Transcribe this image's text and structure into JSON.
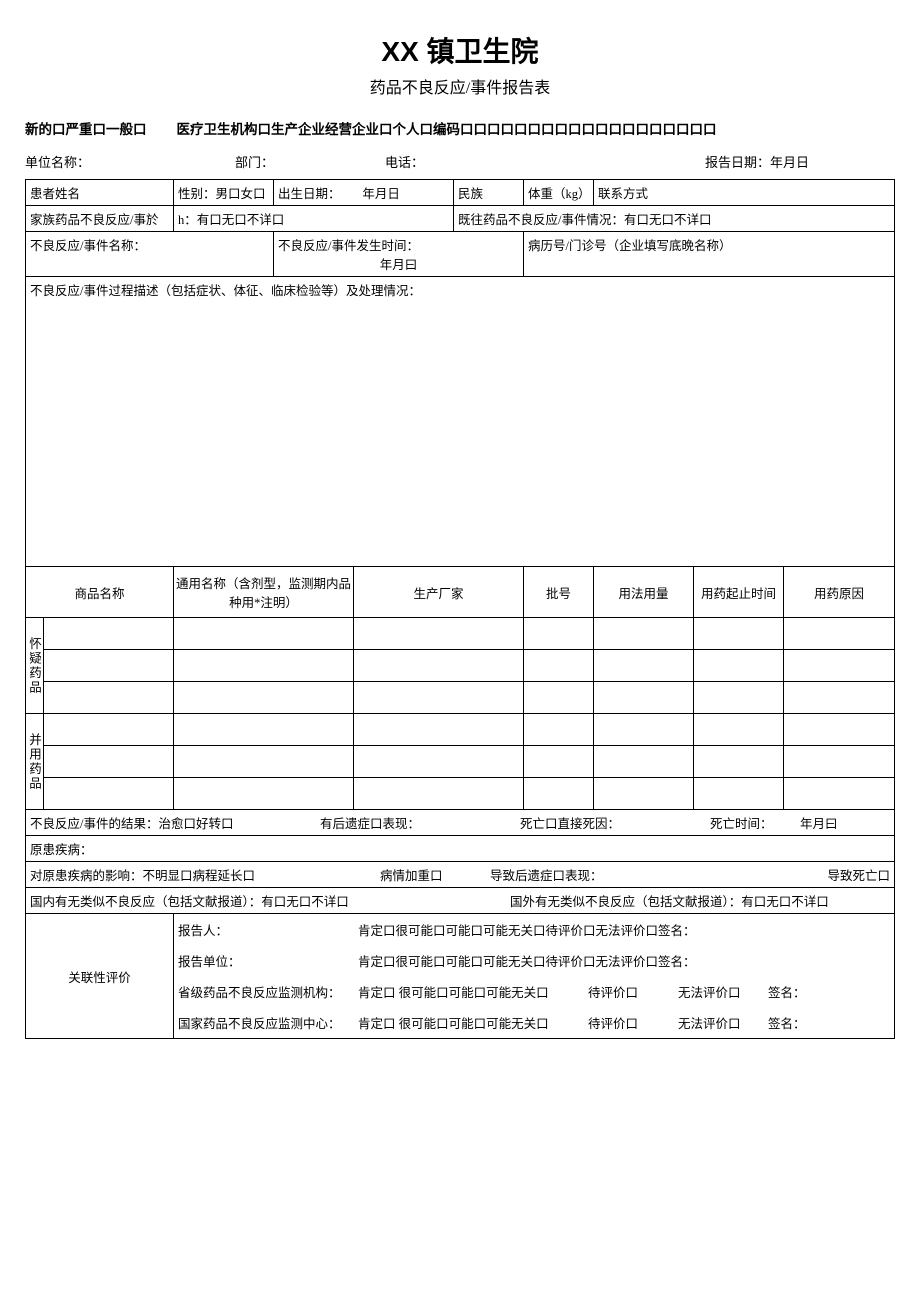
{
  "title": "XX 镇卫生院",
  "subtitle": "药品不良反应/事件报告表",
  "header": {
    "typeLine": "新的口严重口一般口",
    "sourceLine": "医疗卫生机构口生产企业经营企业口个人口编码口口口口口口口口口口口口口口口口口口口"
  },
  "info": {
    "unitLabel": "单位名称：",
    "deptLabel": "部门：",
    "phoneLabel": "电话：",
    "dateLabel": "报告日期：年月日"
  },
  "patient": {
    "nameLabel": "患者姓名",
    "sexLabel": "性别：男口女口",
    "birthLabel": "出生日期：",
    "birthValue": "年月日",
    "ethnicLabel": "民族",
    "weightLabel": "体重（kg）",
    "contactLabel": "联系方式"
  },
  "history": {
    "familyLabel": "家族药品不良反应/事於",
    "familyValue": "h：有口无口不详口",
    "pastLabel": "既往药品不良反应/事件情况：有口无口不详口"
  },
  "event": {
    "nameLabel": "不良反应/事件名称：",
    "timeLabel": "不良反应/事件发生时间：",
    "timeValue": "年月曰",
    "recordLabel": "病历号/门诊号（企业填写底晩名称）",
    "descLabel": "不良反应/事件过程描述（包括症状、体征、临床检验等）及处理情况："
  },
  "drugCols": {
    "tradeName": "商品名称",
    "genericName": "通用名称（含剂型，监测期内品种用*注明）",
    "manufacturer": "生产厂家",
    "batch": "批号",
    "usage": "用法用量",
    "stopTime": "用药起止时间",
    "reason": "用药原因"
  },
  "drugGroups": {
    "suspect": "怀疑药品",
    "combined": "并用药品"
  },
  "outcome": {
    "resultLabel": "不良反应/事件的结果：治愈口好转口",
    "sequelaLabel": "有后遗症口表现：",
    "deathLabel": "死亡口直接死因：",
    "deathTimeLabel": "死亡时间：",
    "deathTimeValue": "年月曰"
  },
  "disease": {
    "label": "原患疾病："
  },
  "impact": {
    "prefix": "对原患疾病的影响：不明显口病程延长口",
    "worse": "病情加重口",
    "sequela": "导致后遗症口表现：",
    "death": "导致死亡口"
  },
  "similar": {
    "domestic": "国内有无类似不良反应（包括文献报道）：有口无口不详口",
    "foreign": "国外有无类似不良反应（包括文献报道）：有口无口不详口"
  },
  "eval": {
    "sectionLabel": "关联性评价",
    "reporter": "报告人：",
    "reportUnit": "报告单位：",
    "provAgency": "省级药品不良反应监测机构：",
    "natAgency": "国家药品不良反应监测中心：",
    "optsLine1": "肯定口很可能口可能口可能无关口待评价口无法评价口签名：",
    "optsLine2a": "肯定口  很可能口可能口可能无关口",
    "optsLine2b": "待评价口",
    "optsLine2c": "无法评价口",
    "sign": "签名："
  }
}
